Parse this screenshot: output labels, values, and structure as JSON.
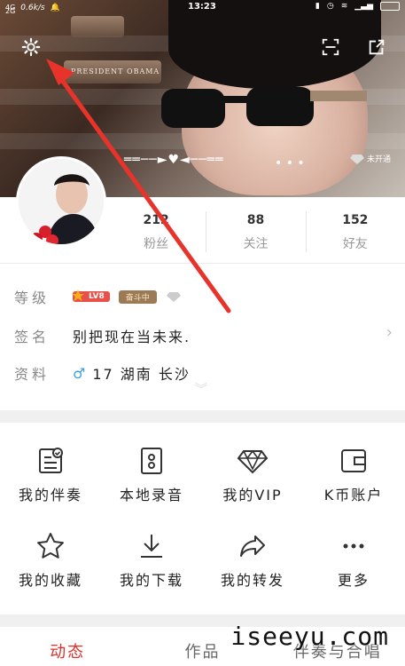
{
  "status_bar": {
    "network": "4G",
    "network2": "2G",
    "speed": "0.6k/s",
    "time": "13:23"
  },
  "header": {
    "plaque_text": "PRESIDENT OBAMA",
    "vip_label": "未开通"
  },
  "stats": [
    {
      "value": "212",
      "label": "粉丝"
    },
    {
      "value": "88",
      "label": "关注"
    },
    {
      "value": "152",
      "label": "好友"
    }
  ],
  "info": {
    "level_label": "等级",
    "level_badge": "LV8",
    "fight_badge": "奋斗中",
    "signature_label": "签名",
    "signature_value": "别把现在当未来.",
    "profile_label": "资料",
    "profile_value": "17 湖南 长沙"
  },
  "grid": [
    {
      "label": "我的伴奏",
      "icon": "accompaniment-icon"
    },
    {
      "label": "本地录音",
      "icon": "recorder-icon"
    },
    {
      "label": "我的VIP",
      "icon": "vip-diamond-icon"
    },
    {
      "label": "K币账户",
      "icon": "wallet-icon"
    },
    {
      "label": "我的收藏",
      "icon": "star-icon"
    },
    {
      "label": "我的下载",
      "icon": "download-icon"
    },
    {
      "label": "我的转发",
      "icon": "share-arrow-icon"
    },
    {
      "label": "更多",
      "icon": "more-icon"
    }
  ],
  "tabs": [
    "动态",
    "作品",
    "伴奏与合唱"
  ],
  "watermark": "iseeyu.com",
  "colors": {
    "accent": "#e0302a",
    "arrow": "#e8332b"
  }
}
